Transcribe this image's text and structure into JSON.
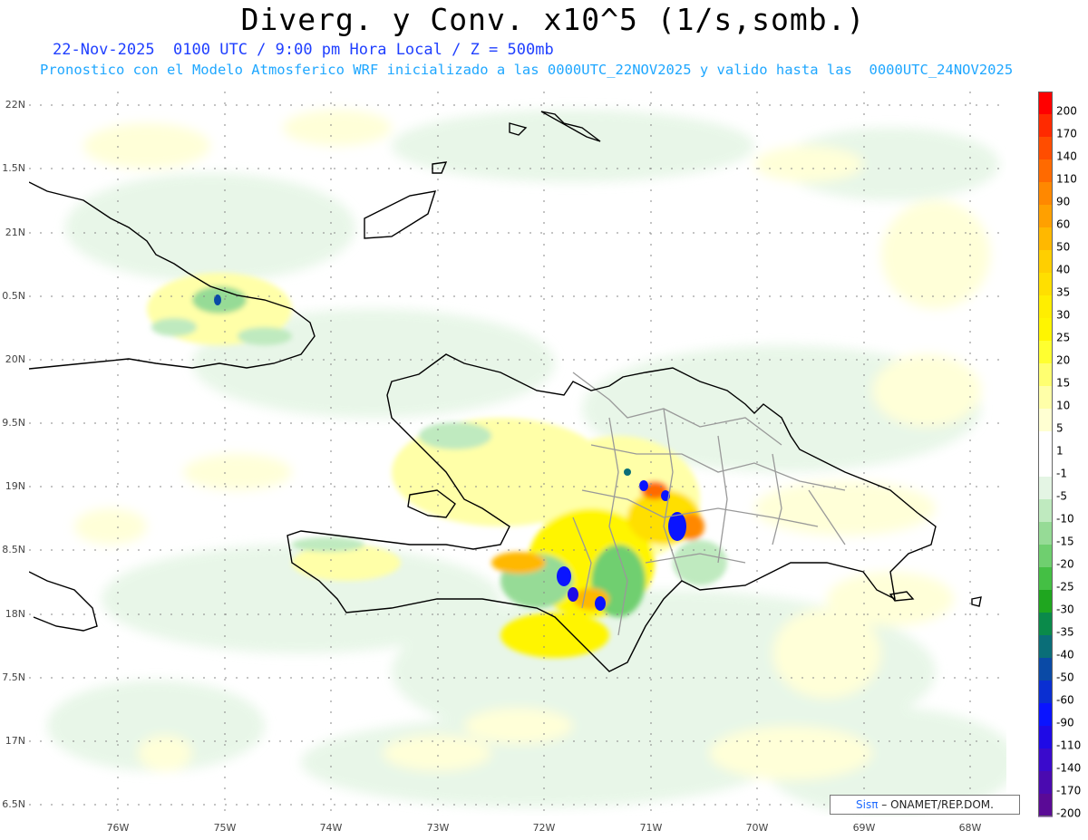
{
  "header": {
    "title": "Diverg. y Conv. x10^5 (1/s,somb.)",
    "subtitle_date": "22-Nov-2025  0100 UTC / 9:00 pm Hora Local / Z = 500mb",
    "subtitle_model": "Pronostico con el Modelo Atmosferico WRF inicializado a las 0000UTC_22NOV2025 y valido hasta las  0000UTC_24NOV2025"
  },
  "axes": {
    "lat_labels": [
      "22N",
      "1.5N",
      "21N",
      "0.5N",
      "20N",
      "9.5N",
      "19N",
      "8.5N",
      "18N",
      "7.5N",
      "17N",
      "6.5N"
    ],
    "lon_labels": [
      "76W",
      "75W",
      "74W",
      "73W",
      "72W",
      "71W",
      "70W",
      "69W",
      "68W"
    ]
  },
  "colorbar": {
    "labels": [
      "200",
      "170",
      "140",
      "110",
      "90",
      "60",
      "50",
      "40",
      "35",
      "30",
      "25",
      "20",
      "15",
      "10",
      "5",
      "1",
      "-1",
      "-5",
      "-10",
      "-15",
      "-20",
      "-25",
      "-30",
      "-35",
      "-40",
      "-50",
      "-60",
      "-90",
      "-110",
      "-140",
      "-170",
      "-200"
    ],
    "colors": [
      "#ff0000",
      "#ff2a00",
      "#ff4d00",
      "#ff6a00",
      "#ff8800",
      "#ffa000",
      "#ffb800",
      "#ffcf00",
      "#ffdf00",
      "#ffee00",
      "#fff500",
      "#ffff30",
      "#ffff70",
      "#ffffa8",
      "#ffffd2",
      "#ffffff",
      "#ffffff",
      "#e4f5e4",
      "#bfeabf",
      "#96db96",
      "#6fcf6f",
      "#44bf44",
      "#1fa61f",
      "#0a8a4a",
      "#0a6e78",
      "#0a4aa6",
      "#0a2fd2",
      "#0a14ff",
      "#1f0ae6",
      "#3a0acc",
      "#4a0ab0",
      "#5a0a96"
    ]
  },
  "credit": {
    "brand": "Sisπ",
    "text": " –  ONAMET/REP.DOM."
  },
  "colors": {
    "title": "#000000",
    "date": "#1f3fff",
    "model": "#1fa7ff",
    "coast": "#000000",
    "borders": "#999999"
  }
}
